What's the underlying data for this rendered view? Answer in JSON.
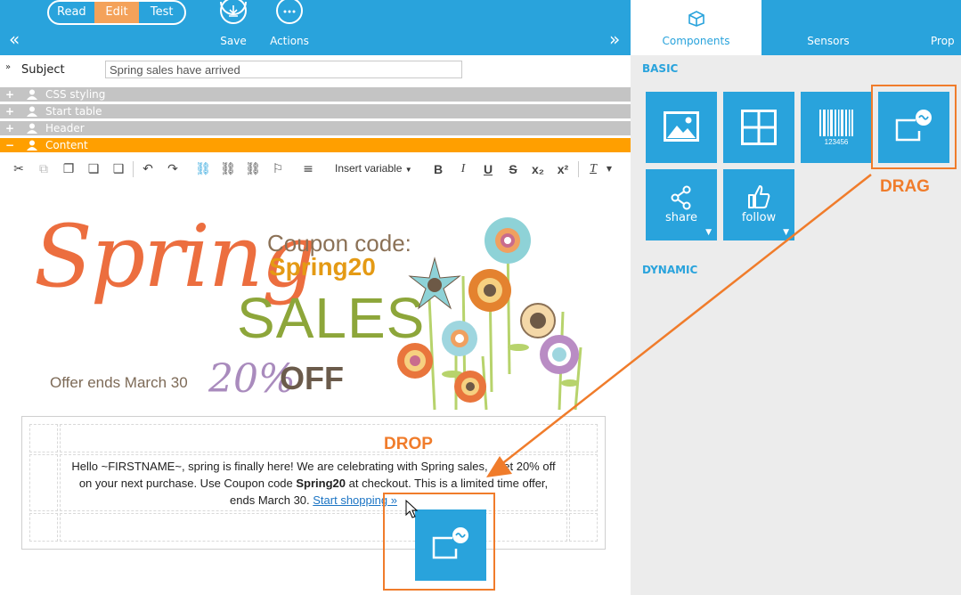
{
  "topbar": {
    "modes": [
      {
        "label": "Read",
        "active": false
      },
      {
        "label": "Edit",
        "active": true
      },
      {
        "label": "Test",
        "active": false
      }
    ],
    "save_label": "Save",
    "actions_label": "Actions",
    "collapse_left_icon": "double-chevron-left-icon",
    "collapse_right_icon": "double-chevron-right-icon"
  },
  "subject": {
    "label": "Subject",
    "value": "Spring sales have arrived"
  },
  "sections": [
    {
      "label": "CSS styling",
      "sign": "+",
      "active": false
    },
    {
      "label": "Start table",
      "sign": "+",
      "active": false
    },
    {
      "label": "Header",
      "sign": "+",
      "active": false
    },
    {
      "label": "Content",
      "sign": "−",
      "active": true
    }
  ],
  "toolbar": {
    "insert_variable_label": "Insert variable"
  },
  "banner": {
    "spring": "Spring",
    "coupon_label": "Coupon code:",
    "coupon_code": "Spring20",
    "sales": "SALES",
    "percent": "20%",
    "off": "OFF",
    "ends": "Offer ends March 30"
  },
  "content": {
    "drop_label": "DROP",
    "line1": "Hello ~FIRSTNAME~, spring is finally here! We are celebrating with Spring sales,",
    "line1_tail": "et 20% off",
    "line2a": "on your next purchase. Use Coupon code",
    "line2_code": "Spring20",
    "line2b": "at checkout. This is a limited time offer,",
    "line3": "ends March 30.",
    "link": "Start shopping »"
  },
  "right_panel": {
    "tabs": [
      {
        "label": "Components",
        "active": true
      },
      {
        "label": "Sensors",
        "active": false
      },
      {
        "label": "Prop",
        "active": false
      }
    ],
    "basic_title": "BASIC",
    "dynamic_title": "DYNAMIC",
    "tiles": [
      {
        "name": "image-icon",
        "label": ""
      },
      {
        "name": "grid-icon",
        "label": ""
      },
      {
        "name": "barcode-icon",
        "label": ""
      },
      {
        "name": "social-box-icon",
        "label": ""
      },
      {
        "name": "share-icon",
        "label": "share"
      },
      {
        "name": "thumbs-up-icon",
        "label": "follow"
      }
    ],
    "barcode_text": "123456",
    "drag_label": "DRAG"
  },
  "colors": {
    "brand_blue": "#29a3dc",
    "accent_orange": "#f07c2b",
    "active_section": "#ff9f00"
  }
}
